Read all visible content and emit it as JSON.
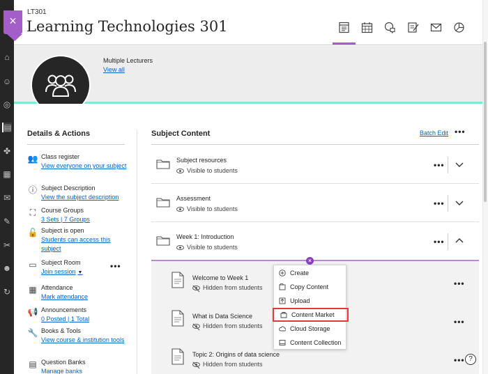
{
  "course": {
    "code": "LT301",
    "title": "Learning Technologies 301"
  },
  "close_label": "×",
  "header_tabs": [
    {
      "name": "content-tab",
      "icon": "content-icon",
      "active": true
    },
    {
      "name": "calendar-tab",
      "icon": "calendar-icon",
      "active": false
    },
    {
      "name": "discussions-tab",
      "icon": "discussions-icon",
      "active": false
    },
    {
      "name": "gradebook-tab",
      "icon": "gradebook-icon",
      "active": false
    },
    {
      "name": "messages-tab",
      "icon": "messages-icon",
      "active": false
    },
    {
      "name": "analytics-tab",
      "icon": "analytics-icon",
      "active": false
    }
  ],
  "banner": {
    "lecturers": "Multiple Lecturers",
    "view_all": "View all"
  },
  "details": {
    "title": "Details & Actions",
    "class_register": {
      "title": "Class register",
      "link": "View everyone on your subject"
    },
    "subject_description": {
      "title": "Subject Description",
      "link": "View the subject description"
    },
    "course_groups": {
      "title": "Course Groups",
      "link": "3 Sets | 7 Groups"
    },
    "subject_open": {
      "title": "Subject is open",
      "link": "Students can access this subject"
    },
    "subject_room": {
      "title": "Subject Room",
      "link": "Join session"
    },
    "attendance": {
      "title": "Attendance",
      "link": "Mark attendance"
    },
    "announcements": {
      "title": "Announcements",
      "link": "0 Posted | 1 Total"
    },
    "books_tools": {
      "title": "Books & Tools",
      "link": "View course & institution tools"
    },
    "question_banks": {
      "title": "Question Banks",
      "link": "Manage banks"
    }
  },
  "subject_content": {
    "title": "Subject Content",
    "batch_edit": "Batch Edit",
    "folders": [
      {
        "title": "Subject resources",
        "visibility": "Visible to students"
      },
      {
        "title": "Assessment",
        "visibility": "Visible to students"
      },
      {
        "title": "Week 1: Introduction",
        "visibility": "Visible to students"
      }
    ],
    "items": [
      {
        "title": "Welcome to Week 1",
        "visibility": "Hidden from students"
      },
      {
        "title": "What is Data Science",
        "visibility": "Hidden from students"
      },
      {
        "title": "Topic 2: Origins of data science",
        "visibility": "Hidden from students"
      }
    ]
  },
  "add_menu": {
    "items": [
      {
        "label": "Create",
        "icon": "plus-circle-icon"
      },
      {
        "label": "Copy Content",
        "icon": "copy-icon"
      },
      {
        "label": "Upload",
        "icon": "upload-icon"
      },
      {
        "label": "Content Market",
        "icon": "content-market-icon",
        "highlighted": true
      },
      {
        "label": "Cloud Storage",
        "icon": "cloud-icon"
      },
      {
        "label": "Content Collection",
        "icon": "collection-icon"
      }
    ]
  },
  "more_label": "•••",
  "help_label": "?"
}
